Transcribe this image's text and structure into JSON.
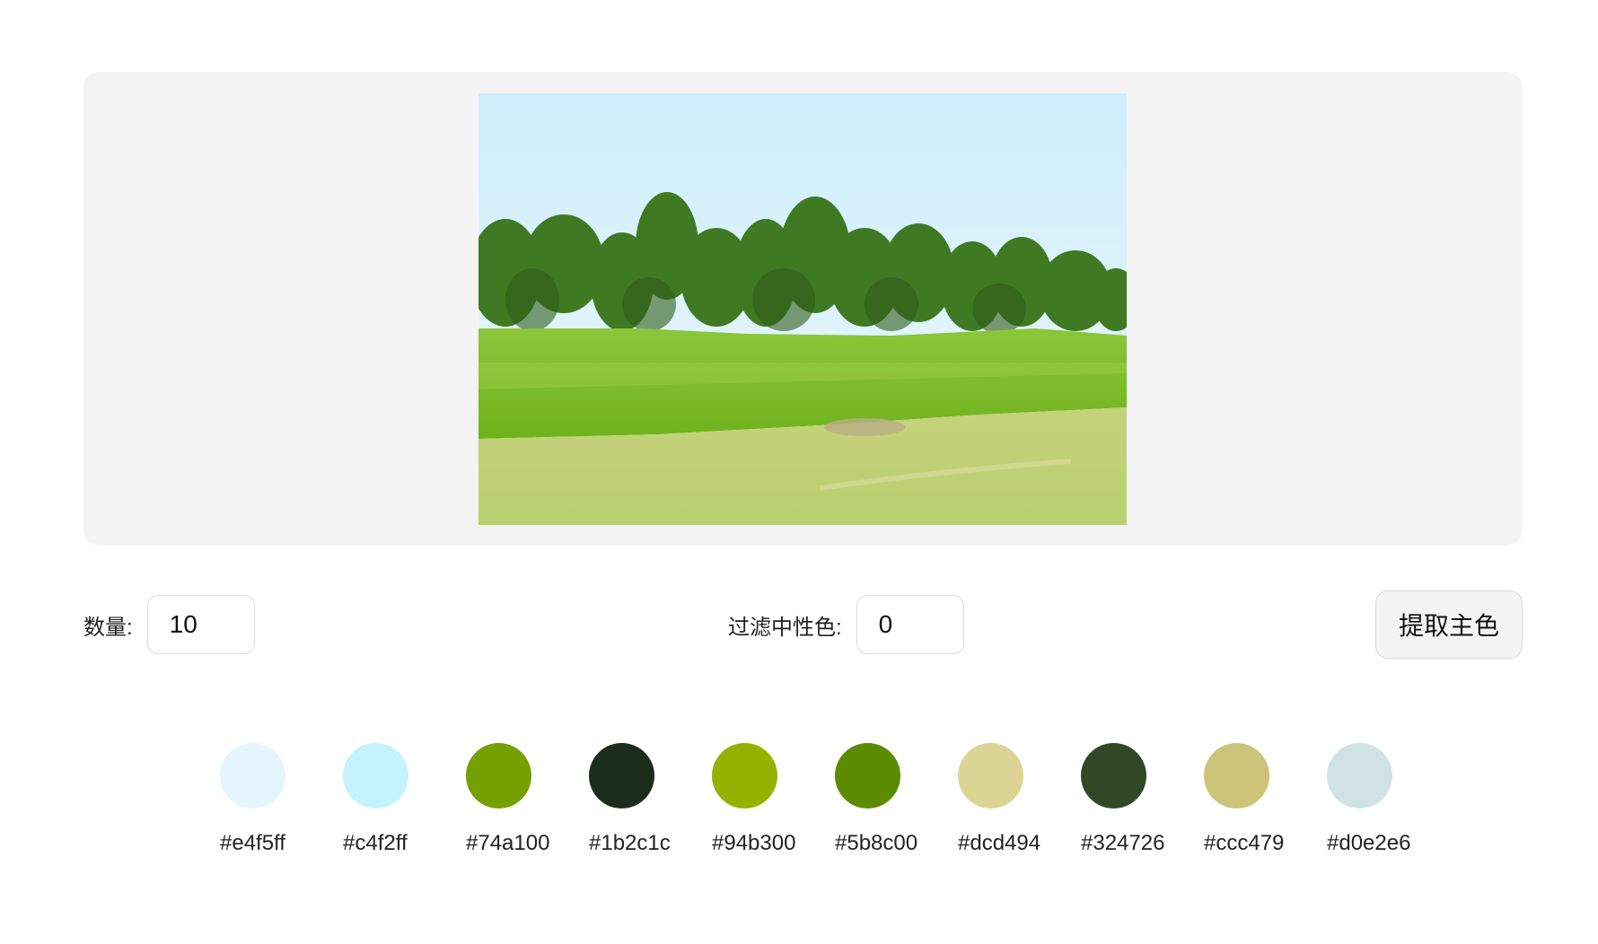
{
  "controls": {
    "count_label": "数量:",
    "count_value": "10",
    "filter_label": "过滤中性色:",
    "filter_value": "0",
    "extract_button": "提取主色"
  },
  "palette": [
    {
      "hex": "#e4f5ff",
      "label": "#e4f5ff"
    },
    {
      "hex": "#c4f2ff",
      "label": "#c4f2ff"
    },
    {
      "hex": "#74a100",
      "label": "#74a100"
    },
    {
      "hex": "#1b2c1c",
      "label": "#1b2c1c"
    },
    {
      "hex": "#94b300",
      "label": "#94b300"
    },
    {
      "hex": "#5b8c00",
      "label": "#5b8c00"
    },
    {
      "hex": "#dcd494",
      "label": "#dcd494"
    },
    {
      "hex": "#324726",
      "label": "#324726"
    },
    {
      "hex": "#ccc479",
      "label": "#ccc479"
    },
    {
      "hex": "#d0e2e6",
      "label": "#d0e2e6"
    }
  ]
}
